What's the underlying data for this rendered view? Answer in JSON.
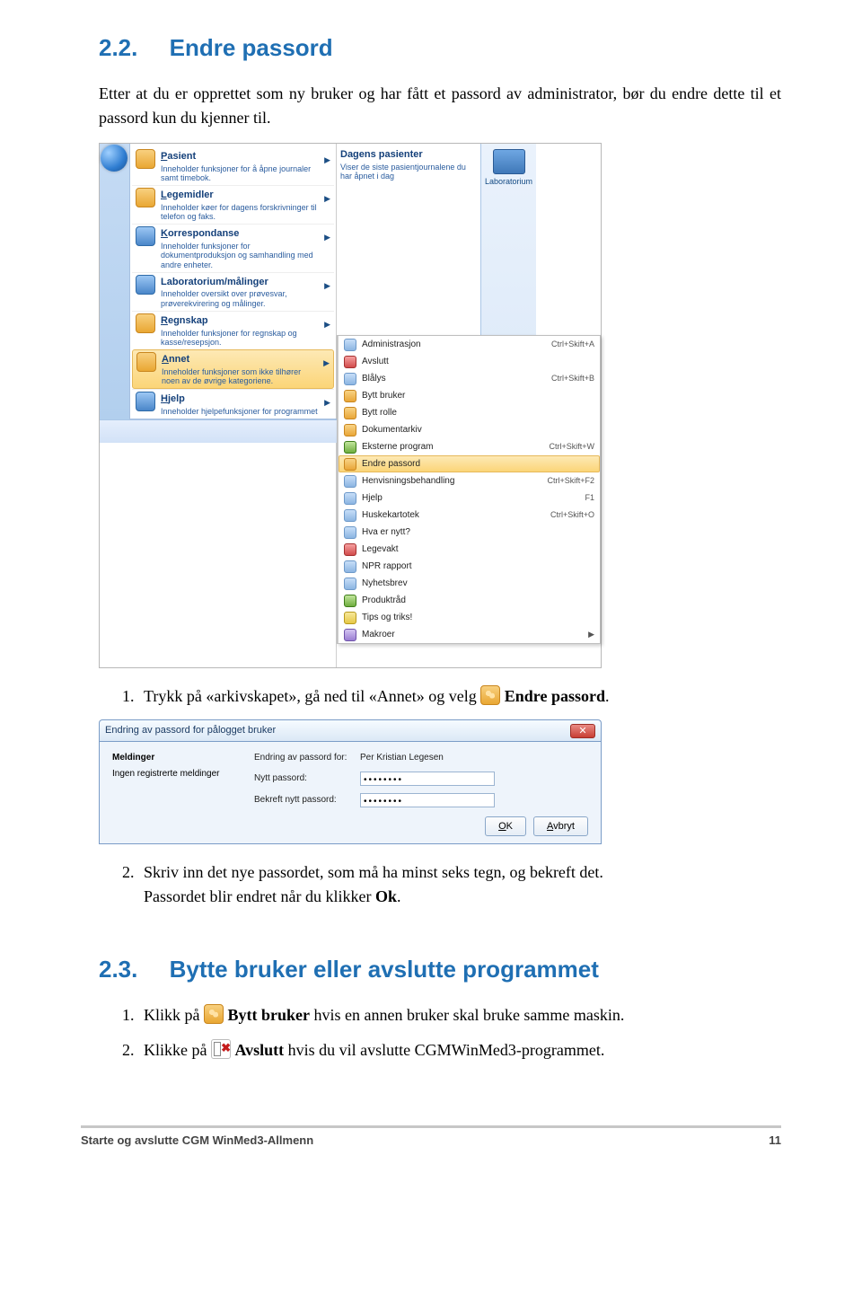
{
  "section1": {
    "number": "2.2.",
    "title": "Endre passord",
    "intro": "Etter at du er opprettet som ny bruker og har fått et passord av administrator, bør du endre dette til et passord kun du kjenner til."
  },
  "menu_screenshot": {
    "left": [
      {
        "title": "Pasient",
        "u": "P",
        "desc": "Inneholder funksjoner for å åpne journaler samt timebok.",
        "arrow": true,
        "icon": "org"
      },
      {
        "title": "Legemidler",
        "u": "L",
        "desc": "Inneholder køer for dagens forskrivninger til telefon og faks.",
        "arrow": true,
        "icon": "org"
      },
      {
        "title": "Korrespondanse",
        "u": "K",
        "desc": "Inneholder funksjoner for dokumentproduksjon og samhandling med andre enheter.",
        "arrow": true,
        "icon": "blue"
      },
      {
        "title": "Laboratorium/målinger",
        "u": "",
        "desc": "Inneholder oversikt over prøvesvar, prøverekvirering og målinger.",
        "arrow": true,
        "icon": "blue"
      },
      {
        "title": "Regnskap",
        "u": "R",
        "desc": "Inneholder funksjoner for regnskap og kasse/resepsjon.",
        "arrow": true,
        "icon": "org"
      },
      {
        "title": "Annet",
        "u": "A",
        "desc": "Inneholder funksjoner som ikke tilhører noen av de øvrige kategoriene.",
        "arrow": true,
        "icon": "org",
        "selected": true
      },
      {
        "title": "Hjelp",
        "u": "H",
        "desc": "Inneholder hjelpefunksjoner for programmet",
        "arrow": true,
        "icon": "blue"
      }
    ],
    "right_panel": {
      "title": "Dagens pasienter",
      "desc": "Viser de siste pasientjournalene du har åpnet i dag"
    },
    "lab": "Laboratorium",
    "bottom": "Produktråd",
    "submenu": [
      {
        "label": "Administrasjon",
        "shortcut": "Ctrl+Skift+A",
        "icon": ""
      },
      {
        "label": "Avslutt",
        "shortcut": "",
        "icon": "red"
      },
      {
        "label": "Blålys",
        "shortcut": "Ctrl+Skift+B",
        "icon": ""
      },
      {
        "label": "Bytt bruker",
        "shortcut": "",
        "icon": "org"
      },
      {
        "label": "Bytt rolle",
        "shortcut": "",
        "icon": "org"
      },
      {
        "label": "Dokumentarkiv",
        "shortcut": "",
        "icon": "org"
      },
      {
        "label": "Eksterne program",
        "shortcut": "Ctrl+Skift+W",
        "icon": "grn"
      },
      {
        "label": "Endre passord",
        "shortcut": "",
        "icon": "org",
        "selected": true
      },
      {
        "label": "Henvisningsbehandling",
        "shortcut": "Ctrl+Skift+F2",
        "icon": ""
      },
      {
        "label": "Hjelp",
        "shortcut": "F1",
        "icon": ""
      },
      {
        "label": "Huskekartotek",
        "shortcut": "Ctrl+Skift+O",
        "icon": ""
      },
      {
        "label": "Hva er nytt?",
        "shortcut": "",
        "icon": ""
      },
      {
        "label": "Legevakt",
        "shortcut": "",
        "icon": "red"
      },
      {
        "label": "NPR rapport",
        "shortcut": "",
        "icon": ""
      },
      {
        "label": "Nyhetsbrev",
        "shortcut": "",
        "icon": ""
      },
      {
        "label": "Produktråd",
        "shortcut": "",
        "icon": "grn"
      },
      {
        "label": "Tips og triks!",
        "shortcut": "",
        "icon": "yel"
      },
      {
        "label": "Makroer",
        "shortcut": "",
        "icon": "pur",
        "arrow": true
      }
    ]
  },
  "step1": {
    "prefix": "Trykk på «arkivskapet», gå ned til «Annet» og velg ",
    "bold": "Endre passord",
    "suffix": "."
  },
  "dialog": {
    "title": "Endring av passord for pålogget bruker",
    "for_label": "Endring av passord for:",
    "for_value": "Per Kristian Legesen",
    "meldinger": "Meldinger",
    "meld_text": "Ingen registrerte meldinger",
    "new_label": "Nytt passord:",
    "confirm_label": "Bekreft nytt passord:",
    "dots": "••••••••",
    "ok": "OK",
    "ok_u": "O",
    "cancel": "Avbryt",
    "cancel_u": "A"
  },
  "step2": {
    "line1": "Skriv inn det nye passordet, som må ha minst seks tegn, og bekreft det.",
    "line2a": "Passordet blir endret når du klikker ",
    "line2b": "Ok",
    "line2c": "."
  },
  "section2": {
    "number": "2.3.",
    "title": "Bytte bruker eller avslutte programmet"
  },
  "step3": {
    "pre": "Klikk på ",
    "bold": "Bytt bruker",
    "post": " hvis en annen bruker skal bruke samme maskin."
  },
  "step4": {
    "pre": "Klikke på ",
    "bold": "Avslutt",
    "post": " hvis du vil avslutte CGMWinMed3-programmet."
  },
  "footer": {
    "left": "Starte og avslutte CGM WinMed3-Allmenn",
    "right": "11"
  }
}
